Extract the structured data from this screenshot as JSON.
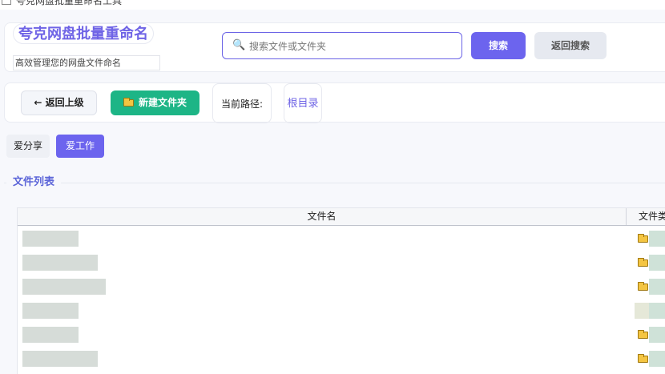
{
  "window": {
    "title": "夸克网盘批量重命名工具"
  },
  "header": {
    "app_title": "夸克网盘批量重命名",
    "app_subtitle": "高效管理您的网盘文件命名"
  },
  "search": {
    "placeholder": "搜索文件或文件夹",
    "value": "",
    "search_label": "搜索",
    "back_label": "返回搜索"
  },
  "toolbar": {
    "up_label": "← 返回上级",
    "new_folder_label": "新建文件夹",
    "path_label": "当前路径:",
    "path_root": "根目录"
  },
  "tabs": [
    {
      "label": "爱分享",
      "active": false
    },
    {
      "label": "爱工作",
      "active": true
    }
  ],
  "file_list": {
    "section_title": "文件列表",
    "columns": [
      "文件名",
      "文件类"
    ],
    "rows": [
      {
        "type_icon": "folder-icon"
      },
      {
        "type_icon": "folder-icon"
      },
      {
        "type_icon": "folder-icon"
      },
      {
        "type_icon": "file-icon"
      },
      {
        "type_icon": "folder-icon"
      },
      {
        "type_icon": "folder-icon"
      }
    ]
  },
  "colors": {
    "accent": "#6c64ee",
    "success": "#1db586",
    "title": "#6f64e6",
    "section_title": "#5b64d8"
  }
}
